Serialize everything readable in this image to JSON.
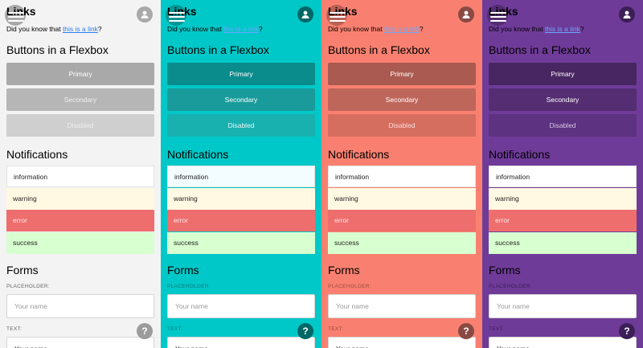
{
  "sections": {
    "links_title": "Links",
    "intro_prefix": "Did you know that ",
    "intro_link": "this is a link",
    "intro_suffix": "?",
    "buttons_title": "Buttons in a Flexbox",
    "notifications_title": "Notifications",
    "forms_title": "Forms"
  },
  "buttons": {
    "primary": "Primary",
    "secondary": "Secondary",
    "disabled": "Disabled"
  },
  "notifications": {
    "information": "information",
    "warning": "warning",
    "error": "error",
    "success": "success"
  },
  "forms": {
    "placeholder_label": "PLACEHOLDER:",
    "placeholder_text": "Your name",
    "text_label": "TEXT:",
    "text_value": "Your name"
  },
  "help_label": "?",
  "themes": [
    {
      "name": "light",
      "background": "#f3f3f3"
    },
    {
      "name": "teal",
      "background": "#00c8c8"
    },
    {
      "name": "coral",
      "background": "#f98070"
    },
    {
      "name": "purple",
      "background": "#6f3b99"
    }
  ],
  "icons": {
    "menu": "hamburger-menu-icon",
    "avatar": "user-avatar-icon",
    "help": "help-icon"
  }
}
